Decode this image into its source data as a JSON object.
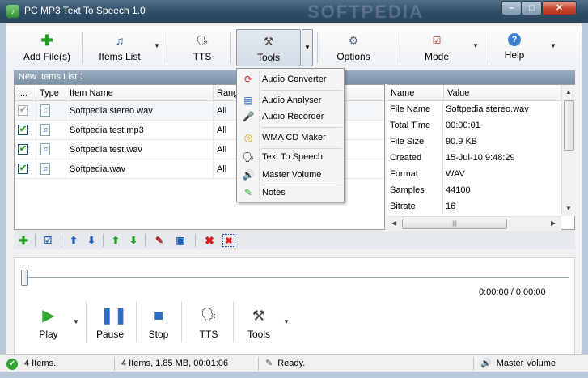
{
  "window": {
    "title": "PC MP3 Text To Speech 1.0",
    "watermark": "SOFTPEDIA",
    "min": "–",
    "max": "□",
    "close": "✕"
  },
  "toolbar": {
    "add_files": "Add File(s)",
    "items_list": "Items List",
    "tts": "TTS",
    "tools": "Tools",
    "options": "Options",
    "mode": "Mode",
    "help": "Help",
    "dropdown": "▼"
  },
  "list": {
    "header": "New Items List 1",
    "columns": [
      "I...",
      "Type",
      "Item Name",
      "Range"
    ],
    "rows": [
      {
        "name": "Softpedia stereo.wav",
        "range": "All",
        "checked": "✔"
      },
      {
        "name": "Softpedia test.mp3",
        "range": "All",
        "checked": "✔"
      },
      {
        "name": "Softpedia test.wav",
        "range": "All",
        "checked": "✔"
      },
      {
        "name": "Softpedia.wav",
        "range": "All",
        "checked": "✔"
      }
    ],
    "file_icon": "♫"
  },
  "properties": {
    "columns": [
      "Name",
      "Value"
    ],
    "rows": [
      {
        "key": "File Name",
        "value": "Softpedia stereo.wav"
      },
      {
        "key": "Total Time",
        "value": "00:00:01"
      },
      {
        "key": "File Size",
        "value": "90.9 KB"
      },
      {
        "key": "Created",
        "value": "15-Jul-10 9:48:29"
      },
      {
        "key": "Format",
        "value": "WAV"
      },
      {
        "key": "Samples",
        "value": "44100"
      },
      {
        "key": "Bitrate",
        "value": "16"
      }
    ]
  },
  "tools_menu": [
    {
      "label": "Audio Converter",
      "icon": "convert-icon"
    },
    {
      "label": "Audio Analyser",
      "icon": "analyser-icon"
    },
    {
      "label": "Audio Recorder",
      "icon": "microphone-icon"
    },
    {
      "label": "WMA CD Maker",
      "icon": "cd-icon"
    },
    {
      "label": "Text To Speech",
      "icon": "tts-icon"
    },
    {
      "label": "Master Volume",
      "icon": "speaker-icon"
    },
    {
      "label": "Notes",
      "icon": "notes-icon"
    }
  ],
  "player": {
    "time": "0:00:00 / 0:00:00",
    "play": "Play",
    "pause": "Pause",
    "stop": "Stop",
    "tts": "TTS",
    "tools": "Tools"
  },
  "status": {
    "items": "4 Items.",
    "summary": "4 Items, 1.85 MB, 00:01:06",
    "state": "Ready.",
    "volume": "Master Volume"
  },
  "colors": {
    "accent_green": "#21a121",
    "accent_blue": "#1f5db5",
    "delete_red": "#d42020"
  }
}
